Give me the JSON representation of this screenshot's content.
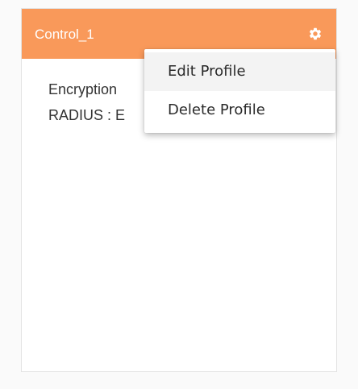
{
  "card": {
    "title": "Control_1",
    "lines": [
      "Encryption",
      "RADIUS : E"
    ]
  },
  "menu": {
    "items": [
      {
        "label": "Edit Profile"
      },
      {
        "label": "Delete Profile"
      }
    ]
  },
  "colors": {
    "header": "#f9995a",
    "background": "#fafafa",
    "card": "#ffffff",
    "menu_hover": "#f3f3f3"
  },
  "icons": {
    "settings": "gear-icon"
  }
}
